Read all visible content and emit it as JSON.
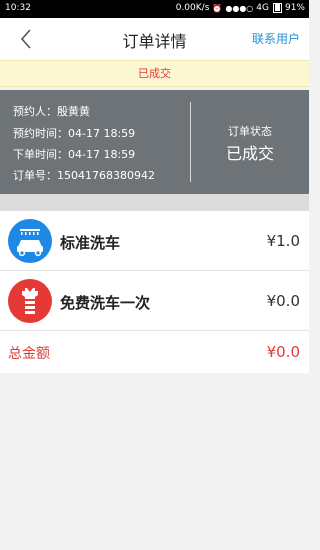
{
  "status_bar": {
    "time": "10:32",
    "net_speed": "0.00K/s",
    "network": "4G",
    "battery": "91%"
  },
  "header": {
    "title": "订单详情",
    "contact_label": "联系用户"
  },
  "banner": {
    "text": "已成交"
  },
  "order_info": {
    "booker": "预约人：殷黄黄",
    "booking_time": "预约时间：04-17  18:59",
    "order_time": "下单时间：04-17  18:59",
    "order_no": "订单号：15041768380942",
    "state_label": "订单状态",
    "state_value": "已成交"
  },
  "items": [
    {
      "icon": "car-wash-icon",
      "name": "标准洗车",
      "price": "¥1.0",
      "color": "#1e88e5"
    },
    {
      "icon": "free-wash-icon",
      "name": "免费洗车一次",
      "price": "¥0.0",
      "color": "#e53935"
    }
  ],
  "total": {
    "label": "总金额",
    "value": "¥0.0"
  },
  "colors": {
    "accent": "#1e93d9",
    "alert": "#e53935",
    "panel": "#6d7377",
    "banner_bg": "#fdf7d1"
  }
}
